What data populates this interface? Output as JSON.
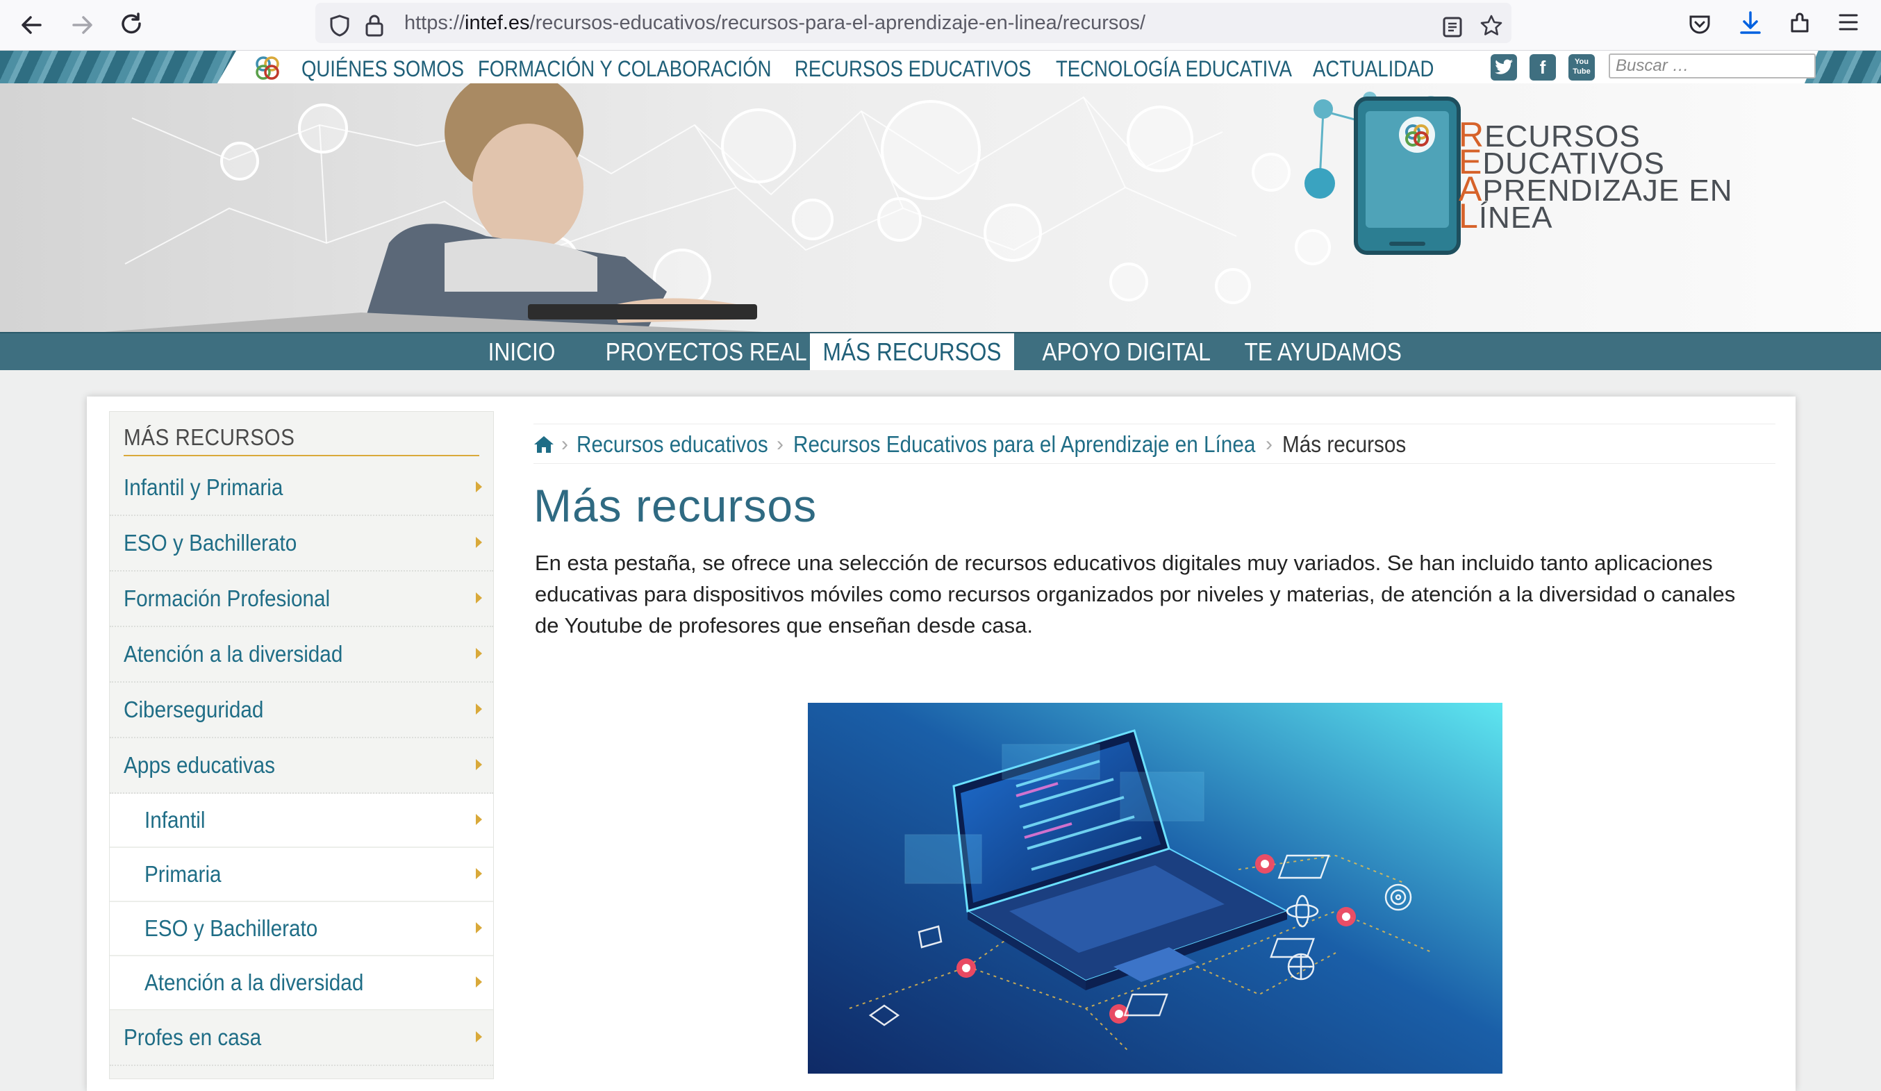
{
  "browser": {
    "url_prefix": "https://",
    "url_domain": "intef.es",
    "url_path": "/recursos-educativos/recursos-para-el-aprendizaje-en-linea/recursos/"
  },
  "top_nav": {
    "items": [
      "QUIÉNES SOMOS",
      "FORMACIÓN Y COLABORACIÓN",
      "RECURSOS EDUCATIVOS",
      "TECNOLOGÍA EDUCATIVA",
      "ACTUALIDAD"
    ],
    "social": [
      "twitter-icon",
      "facebook-icon",
      "youtube-icon"
    ],
    "youtube_label": "You Tube",
    "search_placeholder": "Buscar …"
  },
  "banner": {
    "logo_lines": [
      {
        "cap": "R",
        "rest": "ECURSOS"
      },
      {
        "cap": "E",
        "rest": "DUCATIVOS"
      },
      {
        "cap": "A",
        "rest": "PRENDIZAJE EN"
      },
      {
        "cap": "L",
        "rest": "ÍNEA"
      }
    ]
  },
  "sub_nav": {
    "items": [
      "INICIO",
      "PROYECTOS REAL",
      "MÁS RECURSOS",
      "APOYO DIGITAL",
      "TE AYUDAMOS"
    ],
    "active": "MÁS RECURSOS"
  },
  "sidebar": {
    "title": "MÁS RECURSOS",
    "items": [
      {
        "label": "Infantil y Primaria",
        "level": 1
      },
      {
        "label": "ESO y Bachillerato",
        "level": 1
      },
      {
        "label": "Formación Profesional",
        "level": 1
      },
      {
        "label": "Atención a la diversidad",
        "level": 1
      },
      {
        "label": "Ciberseguridad",
        "level": 1
      },
      {
        "label": "Apps educativas",
        "level": 1
      },
      {
        "label": "Infantil",
        "level": 2
      },
      {
        "label": "Primaria",
        "level": 2
      },
      {
        "label": "ESO y Bachillerato",
        "level": 2
      },
      {
        "label": "Atención a la diversidad",
        "level": 2
      },
      {
        "label": "Profes en casa",
        "level": 1
      }
    ]
  },
  "breadcrumb": [
    "Recursos educativos",
    "Recursos Educativos para el Aprendizaje en Línea",
    "Más recursos"
  ],
  "main": {
    "title": "Más recursos",
    "intro": "En esta pestaña, se ofrece una selección de recursos educativos digitales muy variados. Se han incluido tanto aplicaciones educativas para dispositivos móviles como recursos organizados por niveles y materias, de atención a la diversidad o canales de Youtube de profesores que enseñan desde casa."
  },
  "colors": {
    "brand_teal": "#3e6f80",
    "link": "#1f6d86",
    "accent_gold": "#d9a93a",
    "logo_orange": "#d6622a"
  }
}
